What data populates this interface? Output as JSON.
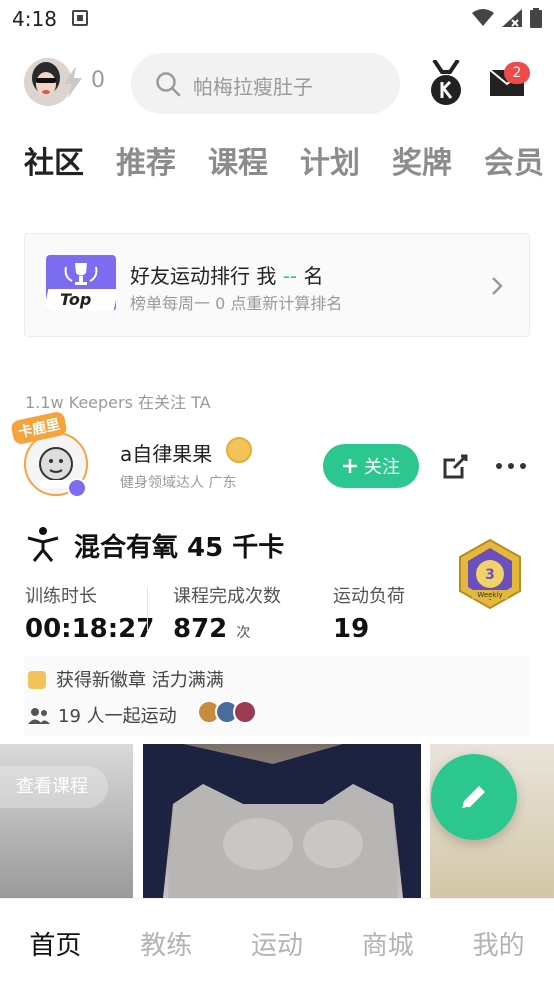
{
  "status_bar": {
    "time": "4:18",
    "icons": [
      "notification-a-icon",
      "wifi-icon",
      "signal-icon",
      "battery-icon"
    ]
  },
  "header": {
    "energy_count": "0",
    "search_placeholder": "帕梅拉瘦肚子",
    "mail_badge": "2"
  },
  "tabs": [
    {
      "label": "社区",
      "active": true
    },
    {
      "label": "推荐",
      "active": false
    },
    {
      "label": "课程",
      "active": false
    },
    {
      "label": "计划",
      "active": false
    },
    {
      "label": "奖牌",
      "active": false
    },
    {
      "label": "会员",
      "active": false
    }
  ],
  "ranking": {
    "badge_text": "Top",
    "title_prefix": "好友运动排行  我 ",
    "title_dash": "--",
    "title_suffix": " 名",
    "subtitle": "榜单每周一 0 点重新计算排名"
  },
  "feed": {
    "followers_text": "1.1w Keepers 在关注 TA",
    "post": {
      "avatar_tag": "卡鹿里",
      "user_name": "a自律果果",
      "user_desc": "健身领域达人 广东",
      "follow_label": "关注",
      "activity_title": "混合有氧 45 千卡",
      "badge_label": "Weekly",
      "stats": [
        {
          "label": "训练时长",
          "value": "00:18:27",
          "unit": ""
        },
        {
          "label": "课程完成次数",
          "value": "872",
          "unit": "次"
        },
        {
          "label": "运动负荷",
          "value": "19",
          "unit": ""
        }
      ],
      "achievement": "获得新徽章 活力满满",
      "together": "19 人一起运动",
      "view_course": "查看课程"
    }
  },
  "bottom_nav": [
    {
      "label": "首页",
      "active": true
    },
    {
      "label": "教练",
      "active": false
    },
    {
      "label": "运动",
      "active": false
    },
    {
      "label": "商城",
      "active": false
    },
    {
      "label": "我的",
      "active": false
    }
  ],
  "colors": {
    "accent": "#2cc68f",
    "badge_red": "#f04b4b",
    "purple": "#7b6cf0"
  }
}
